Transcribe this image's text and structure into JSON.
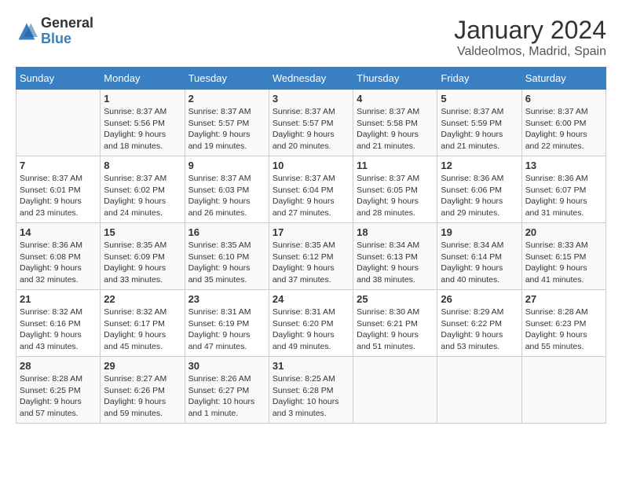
{
  "header": {
    "logo_general": "General",
    "logo_blue": "Blue",
    "month": "January 2024",
    "location": "Valdeolmos, Madrid, Spain"
  },
  "weekdays": [
    "Sunday",
    "Monday",
    "Tuesday",
    "Wednesday",
    "Thursday",
    "Friday",
    "Saturday"
  ],
  "weeks": [
    [
      {
        "day": "",
        "sunrise": "",
        "sunset": "",
        "daylight": ""
      },
      {
        "day": "1",
        "sunrise": "8:37 AM",
        "sunset": "5:56 PM",
        "daylight": "9 hours and 18 minutes."
      },
      {
        "day": "2",
        "sunrise": "8:37 AM",
        "sunset": "5:57 PM",
        "daylight": "9 hours and 19 minutes."
      },
      {
        "day": "3",
        "sunrise": "8:37 AM",
        "sunset": "5:57 PM",
        "daylight": "9 hours and 20 minutes."
      },
      {
        "day": "4",
        "sunrise": "8:37 AM",
        "sunset": "5:58 PM",
        "daylight": "9 hours and 21 minutes."
      },
      {
        "day": "5",
        "sunrise": "8:37 AM",
        "sunset": "5:59 PM",
        "daylight": "9 hours and 21 minutes."
      },
      {
        "day": "6",
        "sunrise": "8:37 AM",
        "sunset": "6:00 PM",
        "daylight": "9 hours and 22 minutes."
      }
    ],
    [
      {
        "day": "7",
        "sunrise": "8:37 AM",
        "sunset": "6:01 PM",
        "daylight": "9 hours and 23 minutes."
      },
      {
        "day": "8",
        "sunrise": "8:37 AM",
        "sunset": "6:02 PM",
        "daylight": "9 hours and 24 minutes."
      },
      {
        "day": "9",
        "sunrise": "8:37 AM",
        "sunset": "6:03 PM",
        "daylight": "9 hours and 26 minutes."
      },
      {
        "day": "10",
        "sunrise": "8:37 AM",
        "sunset": "6:04 PM",
        "daylight": "9 hours and 27 minutes."
      },
      {
        "day": "11",
        "sunrise": "8:37 AM",
        "sunset": "6:05 PM",
        "daylight": "9 hours and 28 minutes."
      },
      {
        "day": "12",
        "sunrise": "8:36 AM",
        "sunset": "6:06 PM",
        "daylight": "9 hours and 29 minutes."
      },
      {
        "day": "13",
        "sunrise": "8:36 AM",
        "sunset": "6:07 PM",
        "daylight": "9 hours and 31 minutes."
      }
    ],
    [
      {
        "day": "14",
        "sunrise": "8:36 AM",
        "sunset": "6:08 PM",
        "daylight": "9 hours and 32 minutes."
      },
      {
        "day": "15",
        "sunrise": "8:35 AM",
        "sunset": "6:09 PM",
        "daylight": "9 hours and 33 minutes."
      },
      {
        "day": "16",
        "sunrise": "8:35 AM",
        "sunset": "6:10 PM",
        "daylight": "9 hours and 35 minutes."
      },
      {
        "day": "17",
        "sunrise": "8:35 AM",
        "sunset": "6:12 PM",
        "daylight": "9 hours and 37 minutes."
      },
      {
        "day": "18",
        "sunrise": "8:34 AM",
        "sunset": "6:13 PM",
        "daylight": "9 hours and 38 minutes."
      },
      {
        "day": "19",
        "sunrise": "8:34 AM",
        "sunset": "6:14 PM",
        "daylight": "9 hours and 40 minutes."
      },
      {
        "day": "20",
        "sunrise": "8:33 AM",
        "sunset": "6:15 PM",
        "daylight": "9 hours and 41 minutes."
      }
    ],
    [
      {
        "day": "21",
        "sunrise": "8:32 AM",
        "sunset": "6:16 PM",
        "daylight": "9 hours and 43 minutes."
      },
      {
        "day": "22",
        "sunrise": "8:32 AM",
        "sunset": "6:17 PM",
        "daylight": "9 hours and 45 minutes."
      },
      {
        "day": "23",
        "sunrise": "8:31 AM",
        "sunset": "6:19 PM",
        "daylight": "9 hours and 47 minutes."
      },
      {
        "day": "24",
        "sunrise": "8:31 AM",
        "sunset": "6:20 PM",
        "daylight": "9 hours and 49 minutes."
      },
      {
        "day": "25",
        "sunrise": "8:30 AM",
        "sunset": "6:21 PM",
        "daylight": "9 hours and 51 minutes."
      },
      {
        "day": "26",
        "sunrise": "8:29 AM",
        "sunset": "6:22 PM",
        "daylight": "9 hours and 53 minutes."
      },
      {
        "day": "27",
        "sunrise": "8:28 AM",
        "sunset": "6:23 PM",
        "daylight": "9 hours and 55 minutes."
      }
    ],
    [
      {
        "day": "28",
        "sunrise": "8:28 AM",
        "sunset": "6:25 PM",
        "daylight": "9 hours and 57 minutes."
      },
      {
        "day": "29",
        "sunrise": "8:27 AM",
        "sunset": "6:26 PM",
        "daylight": "9 hours and 59 minutes."
      },
      {
        "day": "30",
        "sunrise": "8:26 AM",
        "sunset": "6:27 PM",
        "daylight": "10 hours and 1 minute."
      },
      {
        "day": "31",
        "sunrise": "8:25 AM",
        "sunset": "6:28 PM",
        "daylight": "10 hours and 3 minutes."
      },
      {
        "day": "",
        "sunrise": "",
        "sunset": "",
        "daylight": ""
      },
      {
        "day": "",
        "sunrise": "",
        "sunset": "",
        "daylight": ""
      },
      {
        "day": "",
        "sunrise": "",
        "sunset": "",
        "daylight": ""
      }
    ]
  ]
}
